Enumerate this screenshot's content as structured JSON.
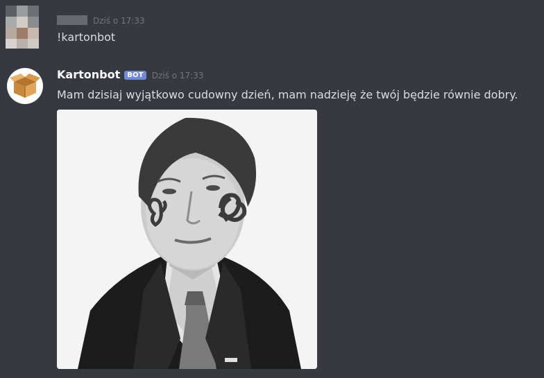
{
  "messages": [
    {
      "author": "",
      "timestamp": "Dziś o 17:33",
      "text": "!kartonbot"
    },
    {
      "author": "Kartonbot",
      "badge": "BOT",
      "timestamp": "Dziś o 17:33",
      "text": "Mam dzisiaj wyjątkowo cudowny dzień, mam nadzieję że twój będzie równie dobry."
    }
  ],
  "colors": {
    "background": "#36393f",
    "username": "#ffffff",
    "text": "#dcddde",
    "timestamp": "#72767d",
    "bot_badge": "#7289da"
  }
}
